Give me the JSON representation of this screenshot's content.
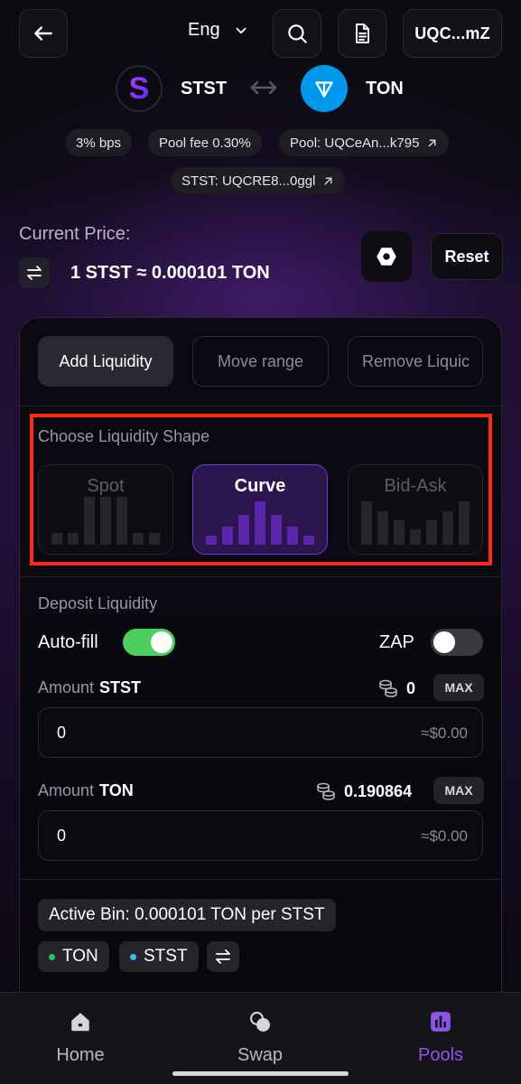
{
  "header": {
    "back_icon": "arrow-left-icon",
    "language": "Eng",
    "search_icon": "search-icon",
    "document_icon": "document-icon",
    "wallet": "UQC...mZ"
  },
  "pair": {
    "token_a": "STST",
    "token_b": "TON",
    "swap_icon": "double-arrow-icon",
    "colors": {
      "stst": "#7b2ff7",
      "ton": "#0098ea"
    }
  },
  "chips": {
    "bps": "3% bps",
    "fee": "Pool fee 0.30%",
    "pool": "Pool: UQCeAn...k795",
    "stst": "STST: UQCRE8...0ggl"
  },
  "price": {
    "title": "Current Price:",
    "value": "1 STST ≈ 0.000101 TON",
    "reset": "Reset"
  },
  "tabs": [
    "Add Liquidity",
    "Move range",
    "Remove Liquic"
  ],
  "shape": {
    "title": "Choose Liquidity Shape",
    "options": [
      "Spot",
      "Curve",
      "Bid-Ask"
    ],
    "selected": "Curve",
    "highlight_color": "#ff2a0f"
  },
  "deposit": {
    "title": "Deposit Liquidity",
    "autofill_label": "Auto-fill",
    "autofill_on": true,
    "zap_label": "ZAP",
    "zap_on": false,
    "amount_label": "Amount",
    "stst": {
      "token": "STST",
      "balance": "0",
      "max": "MAX",
      "value": "0",
      "usd": "≈$0.00"
    },
    "ton": {
      "token": "TON",
      "balance": "0.190864",
      "max": "MAX",
      "value": "0",
      "usd": "≈$0.00"
    }
  },
  "active_bin": {
    "label": "Active Bin: 0.000101 TON per STST",
    "ton": "TON",
    "stst": "STST",
    "ton_color": "#22c55e",
    "stst_color": "#38bdf8"
  },
  "nav": {
    "items": [
      "Home",
      "Swap",
      "Pools"
    ],
    "active": "Pools",
    "accent": "#8e55e8"
  }
}
